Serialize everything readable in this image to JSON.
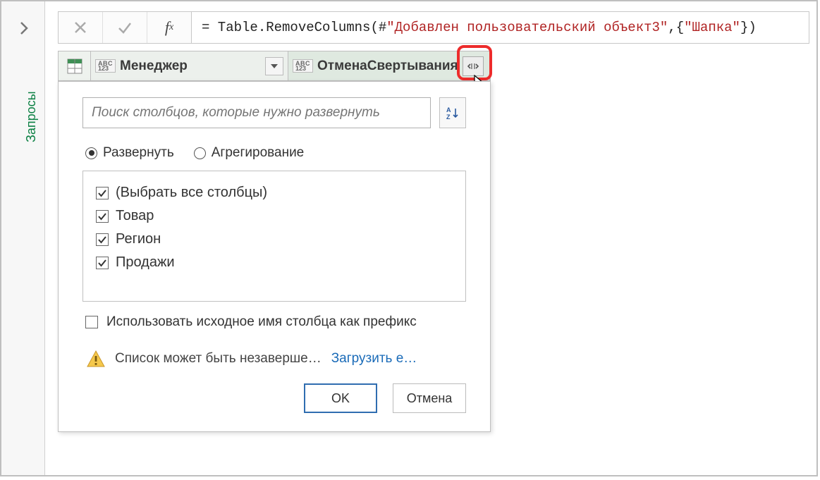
{
  "rail_label": "Запросы",
  "formula": {
    "prefix": "= Table.RemoveColumns(#",
    "str1": "\"Добавлен пользовательский объект3\"",
    "mid": ",{",
    "str2": "\"Шапка\"",
    "suffix": "})"
  },
  "headers": {
    "col1": "Менеджер",
    "col2": "ОтменаСвертывания",
    "type_top": "ABC",
    "type_bot": "123"
  },
  "popup": {
    "search_placeholder": "Поиск столбцов, которые нужно развернуть",
    "radio_expand": "Развернуть",
    "radio_aggregate": "Агрегирование",
    "items": [
      "(Выбрать все столбцы)",
      "Товар",
      "Регион",
      "Продажи"
    ],
    "use_prefix": "Использовать исходное имя столбца как префикс",
    "warning": "Список может быть незаверше…",
    "load_more": "Загрузить е…",
    "ok": "OK",
    "cancel": "Отмена"
  }
}
